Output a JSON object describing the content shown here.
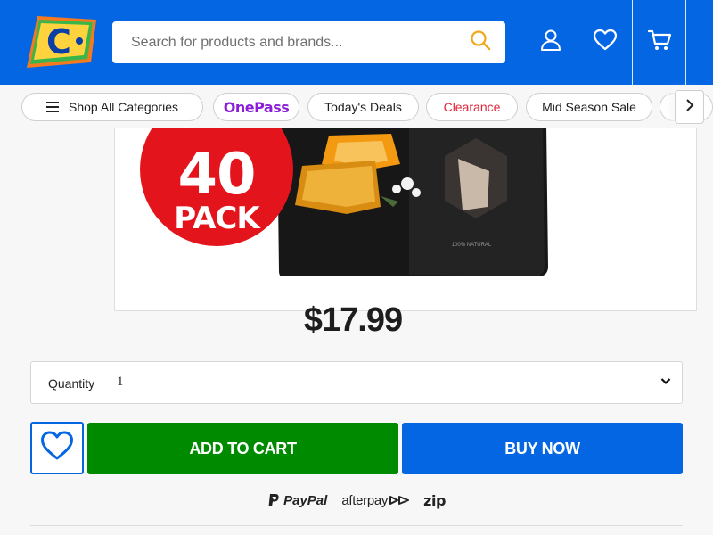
{
  "header": {
    "logo_letter": "C",
    "search_placeholder": "Search for products and brands...",
    "icons": [
      "search-icon",
      "account-icon",
      "wishlist-heart-icon",
      "cart-icon"
    ],
    "colors": {
      "brand_blue": "#0566e3",
      "logo_yellow": "#ffd33d",
      "logo_green": "#3bb54a",
      "logo_orange": "#f47a20"
    }
  },
  "nav": {
    "items": [
      {
        "label": "Shop All Categories",
        "icon": "menu-icon"
      },
      {
        "label": "OnePass"
      },
      {
        "label": "Today's Deals"
      },
      {
        "label": "Clearance"
      },
      {
        "label": "Mid Season Sale"
      }
    ],
    "next_icon": "chevron-right-icon",
    "colors": {
      "onepass": "#8c1ed7",
      "clearance": "#e2263b"
    }
  },
  "product": {
    "badge_number": "40",
    "badge_word": "PACK",
    "package_text": "100% NATURAL",
    "badge_color": "#e4141c"
  },
  "price": "$17.99",
  "quantity": {
    "label": "Quantity",
    "value": "1"
  },
  "actions": {
    "add_to_cart": "ADD TO CART",
    "buy_now": "BUY NOW",
    "colors": {
      "add_to_cart": "#008a00",
      "buy_now": "#0566e3"
    }
  },
  "payments": {
    "paypal": "PayPal",
    "afterpay": "afterpay",
    "zip": "zip"
  }
}
